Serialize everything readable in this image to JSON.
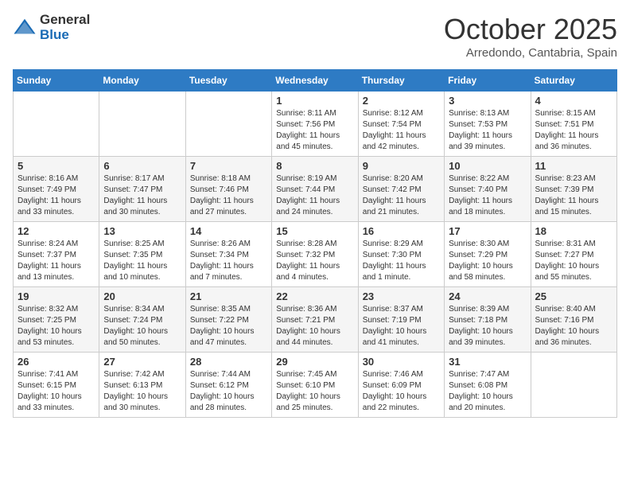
{
  "logo": {
    "general": "General",
    "blue": "Blue"
  },
  "title": "October 2025",
  "subtitle": "Arredondo, Cantabria, Spain",
  "days_of_week": [
    "Sunday",
    "Monday",
    "Tuesday",
    "Wednesday",
    "Thursday",
    "Friday",
    "Saturday"
  ],
  "weeks": [
    [
      {
        "day": "",
        "info": ""
      },
      {
        "day": "",
        "info": ""
      },
      {
        "day": "",
        "info": ""
      },
      {
        "day": "1",
        "info": "Sunrise: 8:11 AM\nSunset: 7:56 PM\nDaylight: 11 hours and 45 minutes."
      },
      {
        "day": "2",
        "info": "Sunrise: 8:12 AM\nSunset: 7:54 PM\nDaylight: 11 hours and 42 minutes."
      },
      {
        "day": "3",
        "info": "Sunrise: 8:13 AM\nSunset: 7:53 PM\nDaylight: 11 hours and 39 minutes."
      },
      {
        "day": "4",
        "info": "Sunrise: 8:15 AM\nSunset: 7:51 PM\nDaylight: 11 hours and 36 minutes."
      }
    ],
    [
      {
        "day": "5",
        "info": "Sunrise: 8:16 AM\nSunset: 7:49 PM\nDaylight: 11 hours and 33 minutes."
      },
      {
        "day": "6",
        "info": "Sunrise: 8:17 AM\nSunset: 7:47 PM\nDaylight: 11 hours and 30 minutes."
      },
      {
        "day": "7",
        "info": "Sunrise: 8:18 AM\nSunset: 7:46 PM\nDaylight: 11 hours and 27 minutes."
      },
      {
        "day": "8",
        "info": "Sunrise: 8:19 AM\nSunset: 7:44 PM\nDaylight: 11 hours and 24 minutes."
      },
      {
        "day": "9",
        "info": "Sunrise: 8:20 AM\nSunset: 7:42 PM\nDaylight: 11 hours and 21 minutes."
      },
      {
        "day": "10",
        "info": "Sunrise: 8:22 AM\nSunset: 7:40 PM\nDaylight: 11 hours and 18 minutes."
      },
      {
        "day": "11",
        "info": "Sunrise: 8:23 AM\nSunset: 7:39 PM\nDaylight: 11 hours and 15 minutes."
      }
    ],
    [
      {
        "day": "12",
        "info": "Sunrise: 8:24 AM\nSunset: 7:37 PM\nDaylight: 11 hours and 13 minutes."
      },
      {
        "day": "13",
        "info": "Sunrise: 8:25 AM\nSunset: 7:35 PM\nDaylight: 11 hours and 10 minutes."
      },
      {
        "day": "14",
        "info": "Sunrise: 8:26 AM\nSunset: 7:34 PM\nDaylight: 11 hours and 7 minutes."
      },
      {
        "day": "15",
        "info": "Sunrise: 8:28 AM\nSunset: 7:32 PM\nDaylight: 11 hours and 4 minutes."
      },
      {
        "day": "16",
        "info": "Sunrise: 8:29 AM\nSunset: 7:30 PM\nDaylight: 11 hours and 1 minute."
      },
      {
        "day": "17",
        "info": "Sunrise: 8:30 AM\nSunset: 7:29 PM\nDaylight: 10 hours and 58 minutes."
      },
      {
        "day": "18",
        "info": "Sunrise: 8:31 AM\nSunset: 7:27 PM\nDaylight: 10 hours and 55 minutes."
      }
    ],
    [
      {
        "day": "19",
        "info": "Sunrise: 8:32 AM\nSunset: 7:25 PM\nDaylight: 10 hours and 53 minutes."
      },
      {
        "day": "20",
        "info": "Sunrise: 8:34 AM\nSunset: 7:24 PM\nDaylight: 10 hours and 50 minutes."
      },
      {
        "day": "21",
        "info": "Sunrise: 8:35 AM\nSunset: 7:22 PM\nDaylight: 10 hours and 47 minutes."
      },
      {
        "day": "22",
        "info": "Sunrise: 8:36 AM\nSunset: 7:21 PM\nDaylight: 10 hours and 44 minutes."
      },
      {
        "day": "23",
        "info": "Sunrise: 8:37 AM\nSunset: 7:19 PM\nDaylight: 10 hours and 41 minutes."
      },
      {
        "day": "24",
        "info": "Sunrise: 8:39 AM\nSunset: 7:18 PM\nDaylight: 10 hours and 39 minutes."
      },
      {
        "day": "25",
        "info": "Sunrise: 8:40 AM\nSunset: 7:16 PM\nDaylight: 10 hours and 36 minutes."
      }
    ],
    [
      {
        "day": "26",
        "info": "Sunrise: 7:41 AM\nSunset: 6:15 PM\nDaylight: 10 hours and 33 minutes."
      },
      {
        "day": "27",
        "info": "Sunrise: 7:42 AM\nSunset: 6:13 PM\nDaylight: 10 hours and 30 minutes."
      },
      {
        "day": "28",
        "info": "Sunrise: 7:44 AM\nSunset: 6:12 PM\nDaylight: 10 hours and 28 minutes."
      },
      {
        "day": "29",
        "info": "Sunrise: 7:45 AM\nSunset: 6:10 PM\nDaylight: 10 hours and 25 minutes."
      },
      {
        "day": "30",
        "info": "Sunrise: 7:46 AM\nSunset: 6:09 PM\nDaylight: 10 hours and 22 minutes."
      },
      {
        "day": "31",
        "info": "Sunrise: 7:47 AM\nSunset: 6:08 PM\nDaylight: 10 hours and 20 minutes."
      },
      {
        "day": "",
        "info": ""
      }
    ]
  ]
}
